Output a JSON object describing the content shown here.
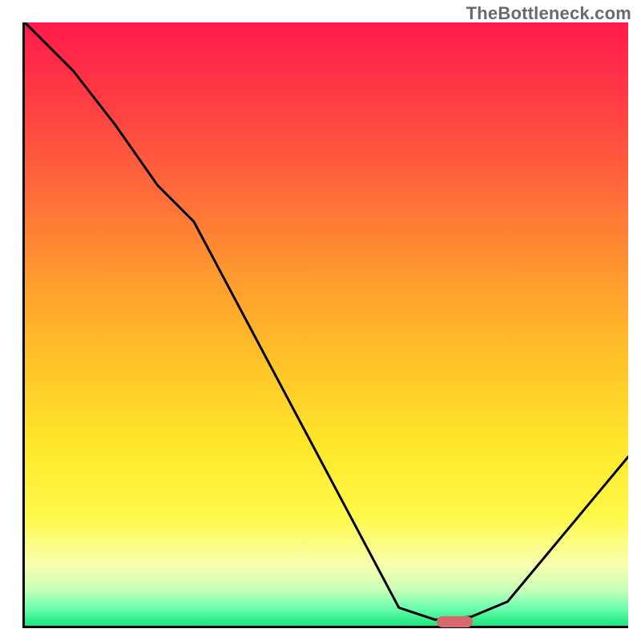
{
  "watermark": "TheBottleneck.com",
  "colors": {
    "border": "#000000",
    "curve": "#000000",
    "marker": "#d56a6e",
    "gradient_top": "#ff1a4b",
    "gradient_bottom": "#19e67a"
  },
  "chart_data": {
    "type": "line",
    "title": "",
    "xlabel": "",
    "ylabel": "",
    "xlim": [
      0,
      100
    ],
    "ylim": [
      0,
      100
    ],
    "x": [
      0,
      8,
      15,
      22,
      28,
      62,
      68,
      74,
      80,
      100
    ],
    "values": [
      100,
      92,
      83,
      73,
      67,
      3,
      1,
      1.5,
      4,
      28
    ],
    "marker": {
      "x_center": 71,
      "y": 1,
      "width_pct": 6
    },
    "annotations": []
  }
}
